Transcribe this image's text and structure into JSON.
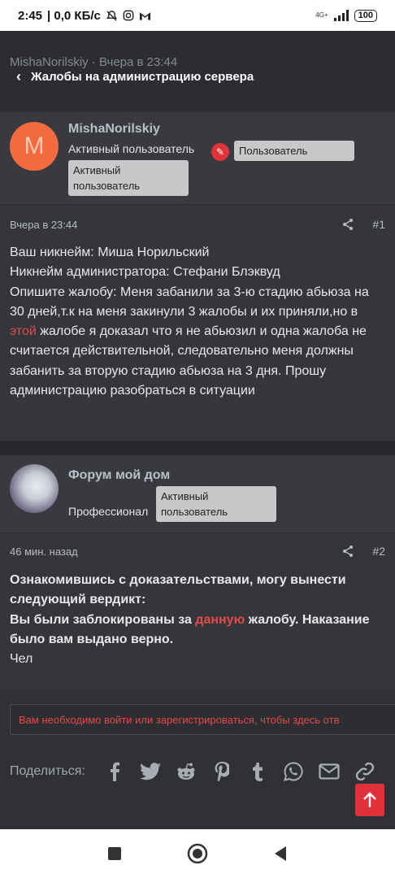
{
  "status_bar": {
    "time": "2:45",
    "speed": "| 0,0 КБ/с",
    "network": "4G+",
    "battery": "100"
  },
  "header": {
    "ghost_text": "MishaNorilskiy · Вчера в 23:44",
    "back_label": "Жалобы на администрацию сервера"
  },
  "posts": [
    {
      "author": "MishaNorilskiy",
      "avatar_letter": "M",
      "user_title": "Активный пользователь",
      "badges": [
        "Пользователь",
        "Активный пользователь"
      ],
      "time": "Вчера в 23:44",
      "number": "#1",
      "lines": {
        "l1": "Ваш никнейм: Миша Норильский",
        "l2": "Никнейм администратора: Стефани Блэквуд",
        "l3a": "Опишите жалобу: Меня забанили за 3-ю стадию абьюза на 30 дней,т.к на меня закинули 3 жалобы и их приняли,но в ",
        "l3hl": "этой",
        "l3b": " жалобе я доказал что я не абьюзил и одна жалоба не считается действительной, следовательно меня должны забанить за вторую стадию абьюза на 3 дня. Прошу администрацию разобраться в ситуации"
      }
    },
    {
      "author": "Форум мой дом",
      "user_title": "Профессионал",
      "badges": [
        "Активный пользователь"
      ],
      "time": "46 мин. назад",
      "number": "#2",
      "lines": {
        "l1": "Ознакомившись с доказательствами, могу вынести следующий вердикт:",
        "l2a": "Вы были заблокированы за ",
        "l2hl": "данную",
        "l2b": " жалобу. Наказание было вам выдано верно.",
        "l3": "Чел"
      }
    }
  ],
  "login_notice": "Вам необходимо войти или зарегистрироваться, чтобы здесь отв",
  "share": {
    "label": "Поделиться:",
    "icons": [
      "facebook-icon",
      "twitter-icon",
      "reddit-icon",
      "pinterest-icon",
      "tumblr-icon",
      "whatsapp-icon",
      "email-icon",
      "link-icon"
    ]
  },
  "colors": {
    "background": "#2f3136",
    "accent_red": "#e0303a",
    "avatar_orange": "#f26a3d",
    "highlight": "#e14b4b"
  }
}
